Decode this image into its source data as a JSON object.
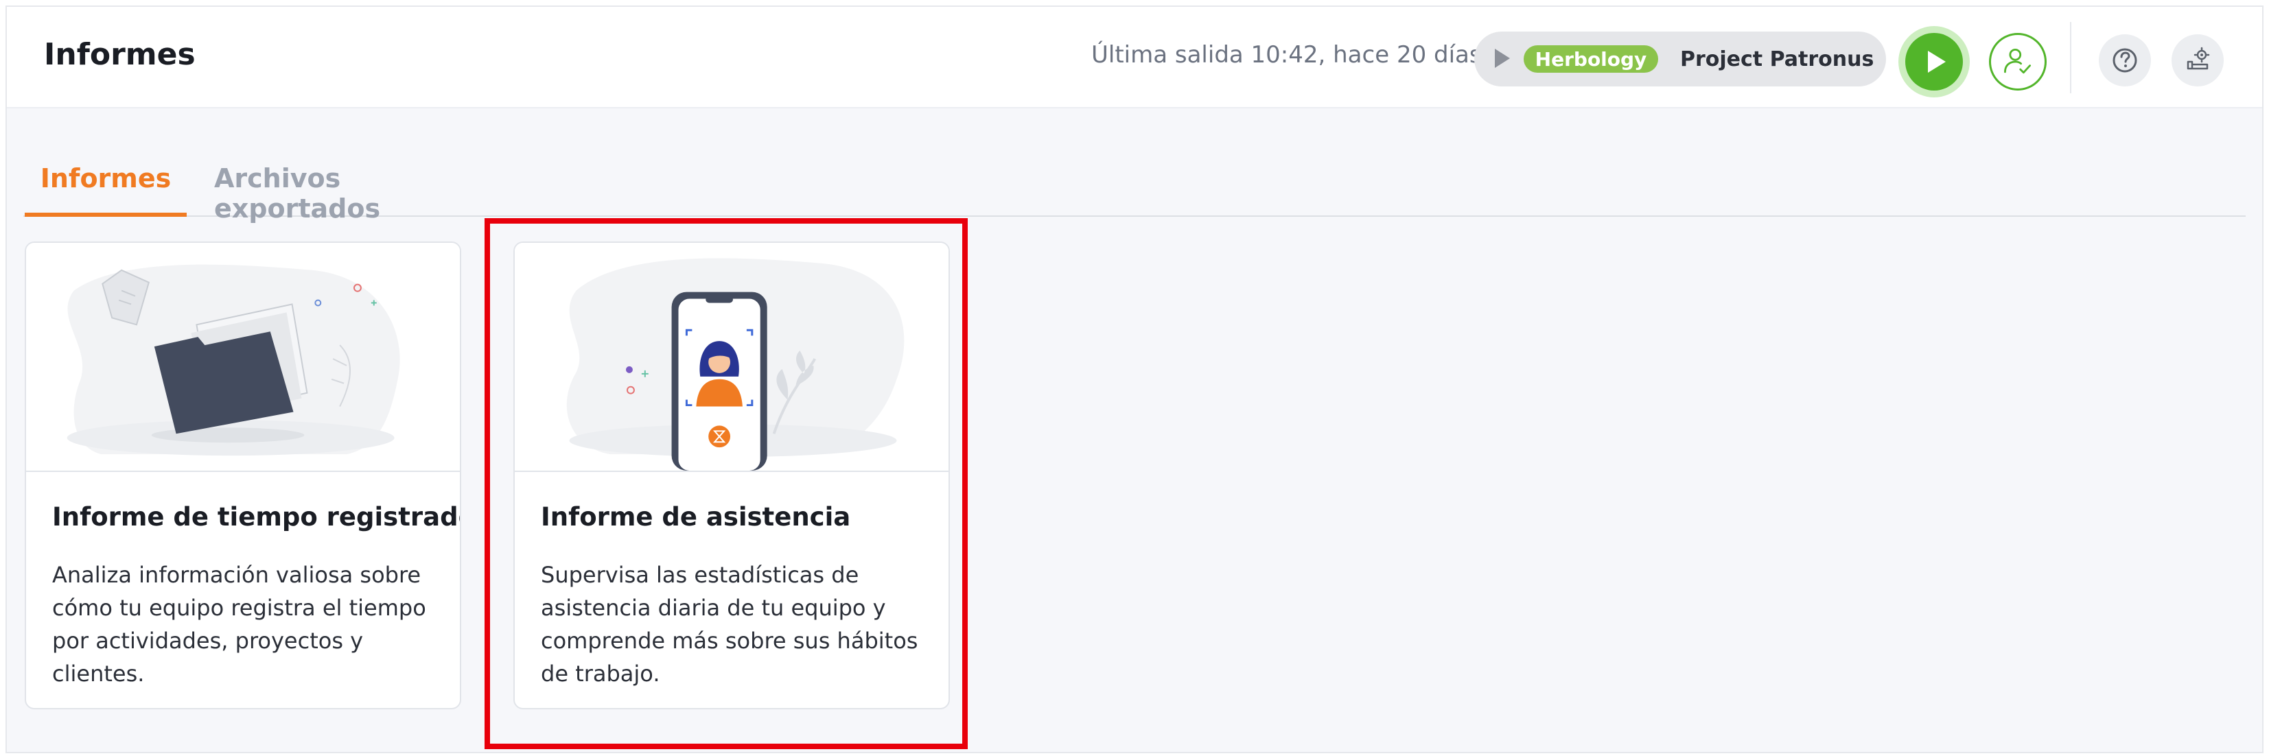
{
  "header": {
    "title": "Informes",
    "last_exit": "Última salida 10:42, hace 20 días",
    "timer": {
      "tag": "Herbology",
      "project": "Project Patronus"
    },
    "icons": {
      "play": "play-icon",
      "attendance": "user-check-icon",
      "help": "question-circle-icon",
      "settings": "settings-icon"
    }
  },
  "tabs": [
    {
      "label": "Informes",
      "active": true
    },
    {
      "label": "Archivos exportados",
      "active": false
    }
  ],
  "cards": [
    {
      "title": "Informe de tiempo registrado",
      "description": "Analiza información valiosa sobre cómo tu equipo registra el tiempo por actividades, proyectos y clientes.",
      "illustration": "folder-illustration"
    },
    {
      "title": "Informe de asistencia",
      "description": "Supervisa las estadísticas de asistencia diaria de tu equipo y comprende más sobre sus hábitos de trabajo.",
      "illustration": "phone-face-scan-illustration"
    }
  ],
  "colors": {
    "accent": "#f07b22",
    "green": "#52b52a",
    "tag_green": "#8bc34a",
    "highlight": "#e8000b"
  }
}
